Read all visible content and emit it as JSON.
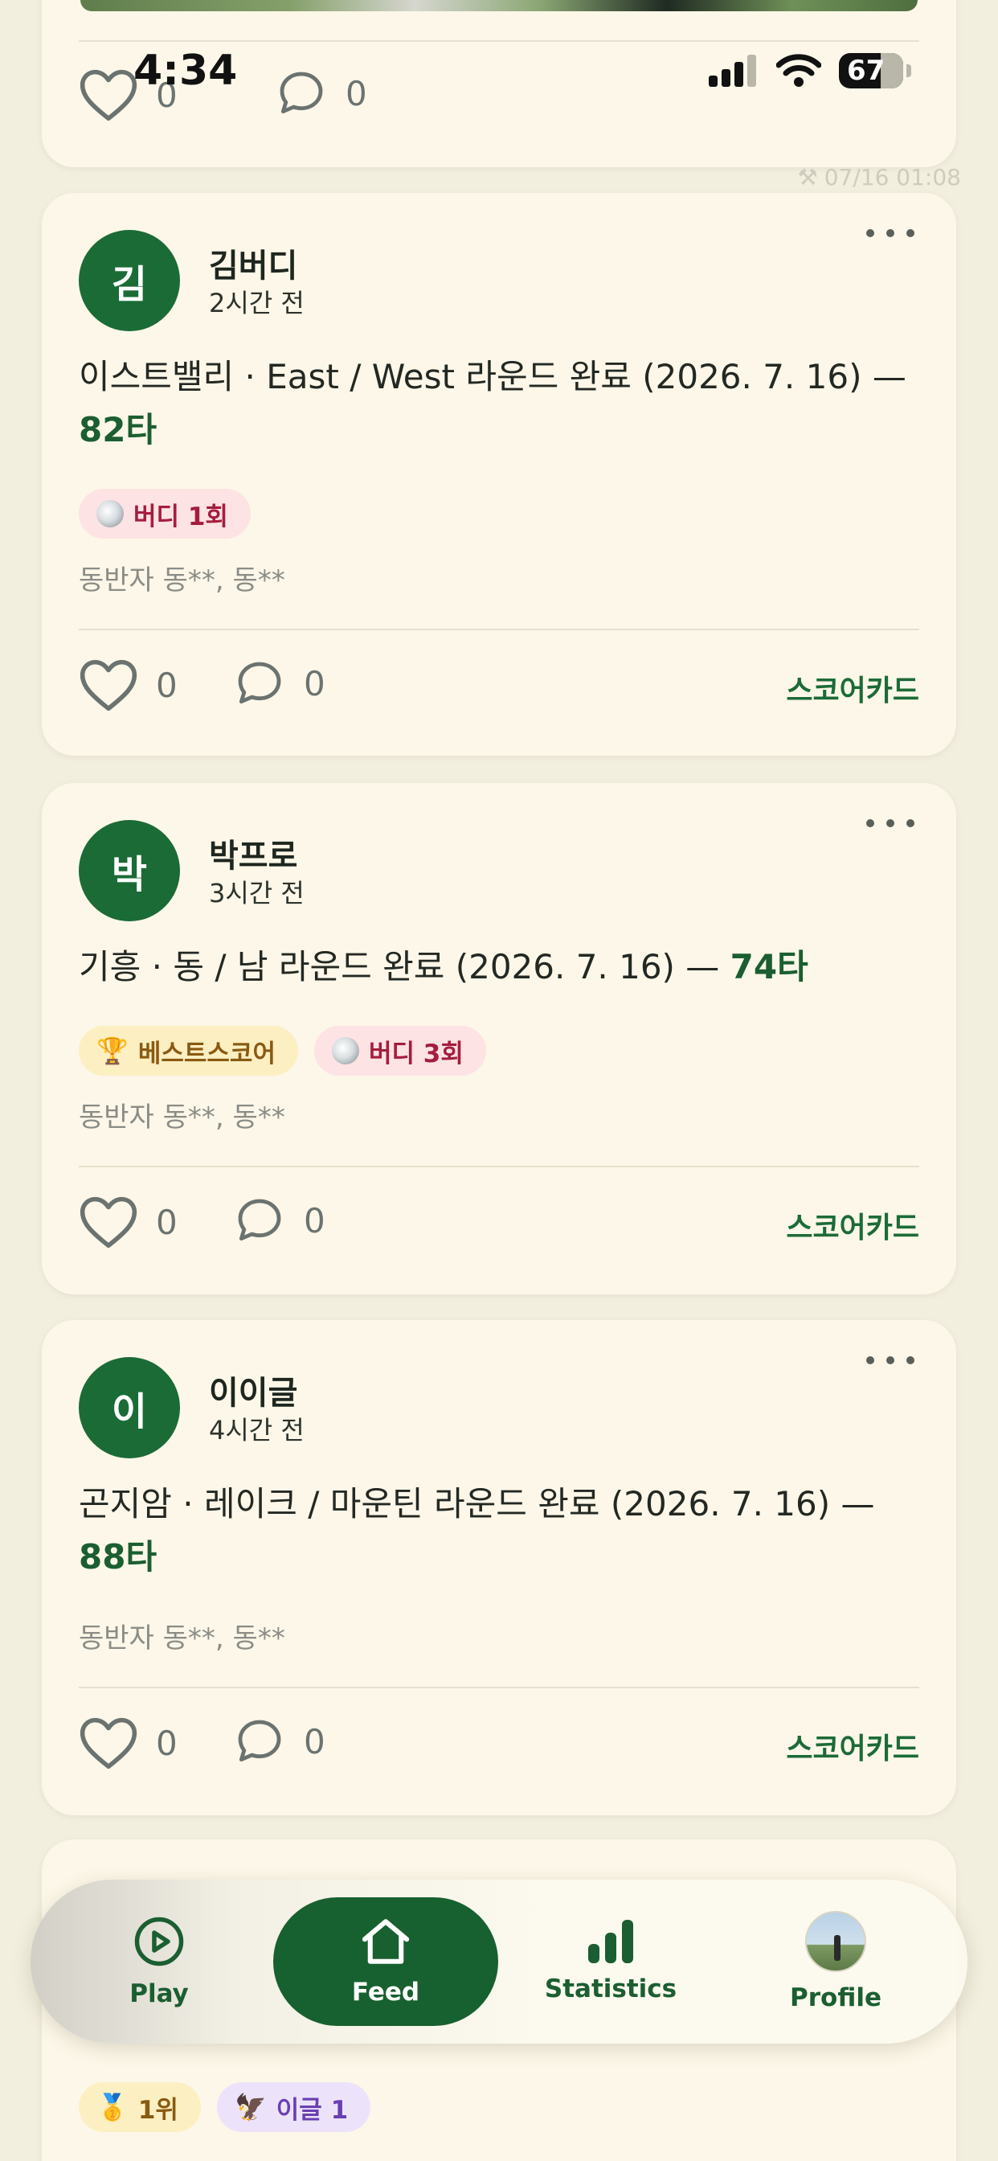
{
  "status_bar": {
    "time": "4:34",
    "battery": "67"
  },
  "debug_stamp": "07/16 01:08",
  "previous_post": {
    "likes": "0",
    "comments": "0"
  },
  "posts": [
    {
      "avatar": "김",
      "name": "김버디",
      "time": "2시간 전",
      "summary_prefix": "이스트밸리 · East / West 라운드 완료 (2026. 7. 16) —",
      "score": "82타",
      "badges": [
        {
          "icon": "golf-ball-icon",
          "label": "버디 1회",
          "style": "pink"
        }
      ],
      "companions": "동반자 동**, 동**",
      "likes": "0",
      "comments": "0",
      "scorecard_label": "스코어카드"
    },
    {
      "avatar": "박",
      "name": "박프로",
      "time": "3시간 전",
      "summary_prefix": "기흥 · 동 / 남 라운드 완료 (2026. 7. 16) —",
      "score": "74타",
      "badges": [
        {
          "icon": "trophy-icon",
          "emoji": "🏆",
          "label": "베스트스코어",
          "style": "yellow"
        },
        {
          "icon": "golf-ball-icon",
          "label": "버디 3회",
          "style": "pink"
        }
      ],
      "companions": "동반자 동**, 동**",
      "likes": "0",
      "comments": "0",
      "scorecard_label": "스코어카드"
    },
    {
      "avatar": "이",
      "name": "이이글",
      "time": "4시간 전",
      "summary_prefix": "곤지암 · 레이크 / 마운틴 라운드 완료 (2026. 7. 16) —",
      "score": "88타",
      "badges": [],
      "companions": "동반자 동**, 동**",
      "likes": "0",
      "comments": "0",
      "scorecard_label": "스코어카드"
    }
  ],
  "partial_post": {
    "badges": [
      {
        "icon": "gold-medal-icon",
        "emoji": "🥇",
        "label": "1위",
        "style": "yellow"
      },
      {
        "icon": "eagle-icon",
        "emoji": "🦅",
        "label": "이글 1",
        "style": "purple"
      }
    ]
  },
  "tabbar": {
    "play": "Play",
    "feed": "Feed",
    "statistics": "Statistics",
    "profile": "Profile",
    "active": "feed"
  },
  "colors": {
    "accent": "#1b6b37",
    "background": "#f3efdf",
    "card": "#fcf7e8"
  }
}
